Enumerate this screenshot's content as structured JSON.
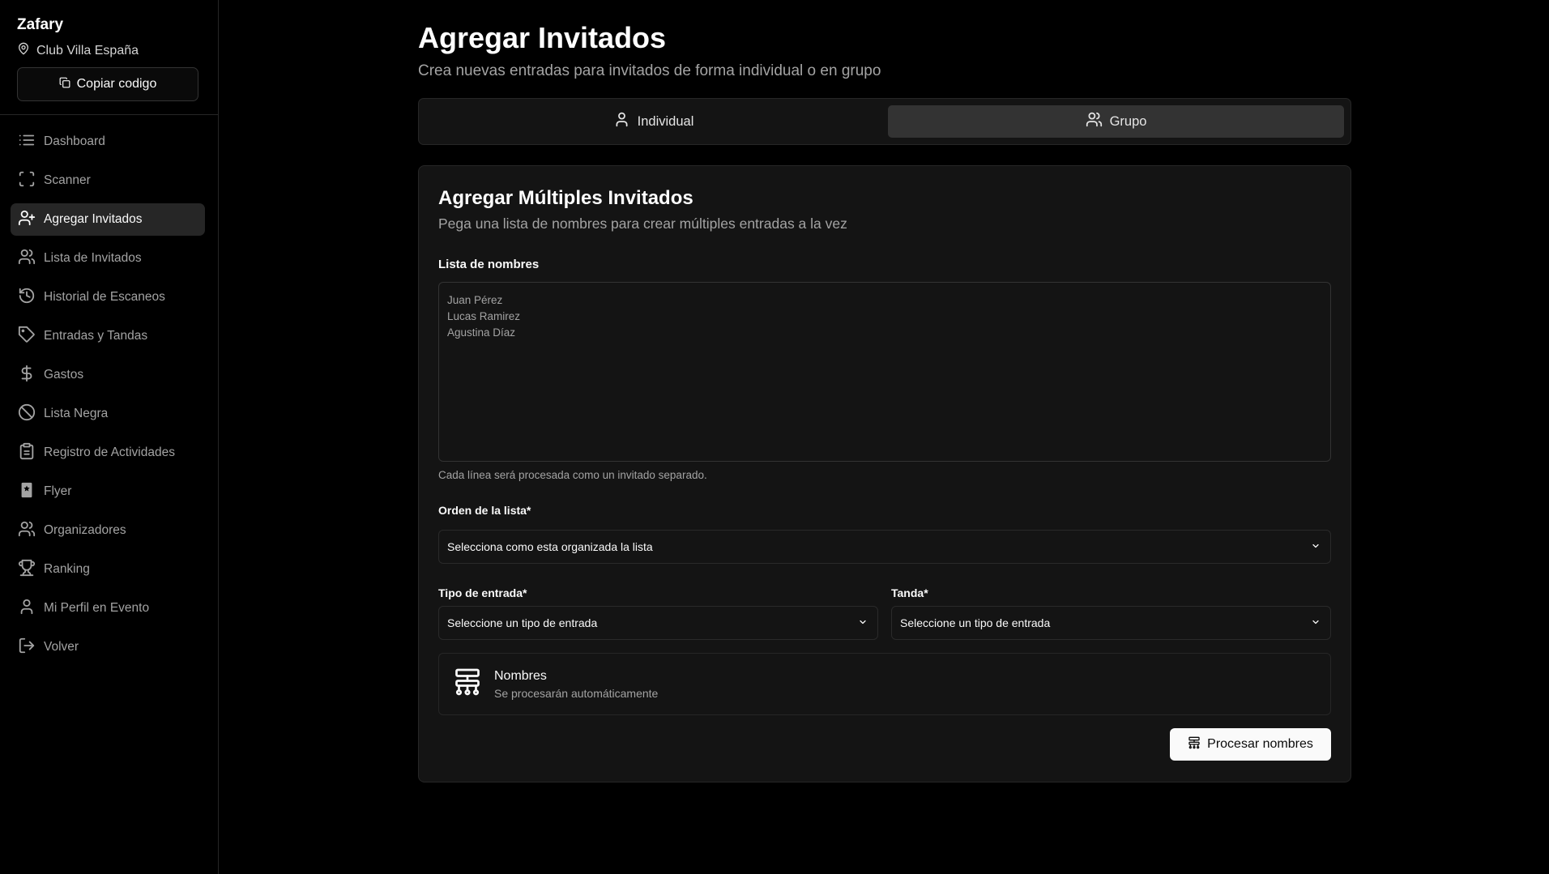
{
  "sidebar": {
    "brand": "Zafary",
    "venue": "Club Villa España",
    "copy_label": "Copiar codigo",
    "items": [
      {
        "label": "Dashboard",
        "icon": "list-icon"
      },
      {
        "label": "Scanner",
        "icon": "scan-icon"
      },
      {
        "label": "Agregar Invitados",
        "icon": "user-plus-icon",
        "active": true
      },
      {
        "label": "Lista de Invitados",
        "icon": "users-icon"
      },
      {
        "label": "Historial de Escaneos",
        "icon": "history-icon"
      },
      {
        "label": "Entradas y Tandas",
        "icon": "tag-icon"
      },
      {
        "label": "Gastos",
        "icon": "dollar-icon"
      },
      {
        "label": "Lista Negra",
        "icon": "ban-icon"
      },
      {
        "label": "Registro de Actividades",
        "icon": "clipboard-icon"
      },
      {
        "label": "Flyer",
        "icon": "flyer-icon"
      },
      {
        "label": "Organizadores",
        "icon": "users-icon"
      },
      {
        "label": "Ranking",
        "icon": "trophy-icon"
      },
      {
        "label": "Mi Perfil en Evento",
        "icon": "user-icon"
      },
      {
        "label": "Volver",
        "icon": "logout-icon"
      }
    ]
  },
  "header": {
    "title": "Agregar Invitados",
    "subtitle": "Crea nuevas entradas para invitados de forma individual o en grupo"
  },
  "tabs": {
    "individual": "Individual",
    "group": "Grupo",
    "active": "group"
  },
  "card": {
    "title": "Agregar Múltiples Invitados",
    "subtitle": "Pega una lista de nombres para crear múltiples entradas a la vez",
    "list_label": "Lista de nombres",
    "list_placeholder": "Juan Pérez\nLucas Ramirez\nAgustina Díaz",
    "list_hint": "Cada línea será procesada como un invitado separado.",
    "order_label": "Orden de la lista*",
    "order_placeholder": "Selecciona como esta organizada la lista",
    "ticket_type_label": "Tipo de entrada*",
    "ticket_type_placeholder": "Seleccione un tipo de entrada",
    "tanda_label": "Tanda*",
    "tanda_placeholder": "Seleccione un tipo de entrada",
    "process_title": "Nombres",
    "process_subtitle": "Se procesarán automáticamente",
    "process_button": "Procesar nombres"
  },
  "colors": {
    "background": "#000000",
    "panel": "#141414",
    "border": "#262626",
    "active_tab": "#333333",
    "muted_text": "#a3a3a3",
    "primary_button": "#fafafa"
  }
}
